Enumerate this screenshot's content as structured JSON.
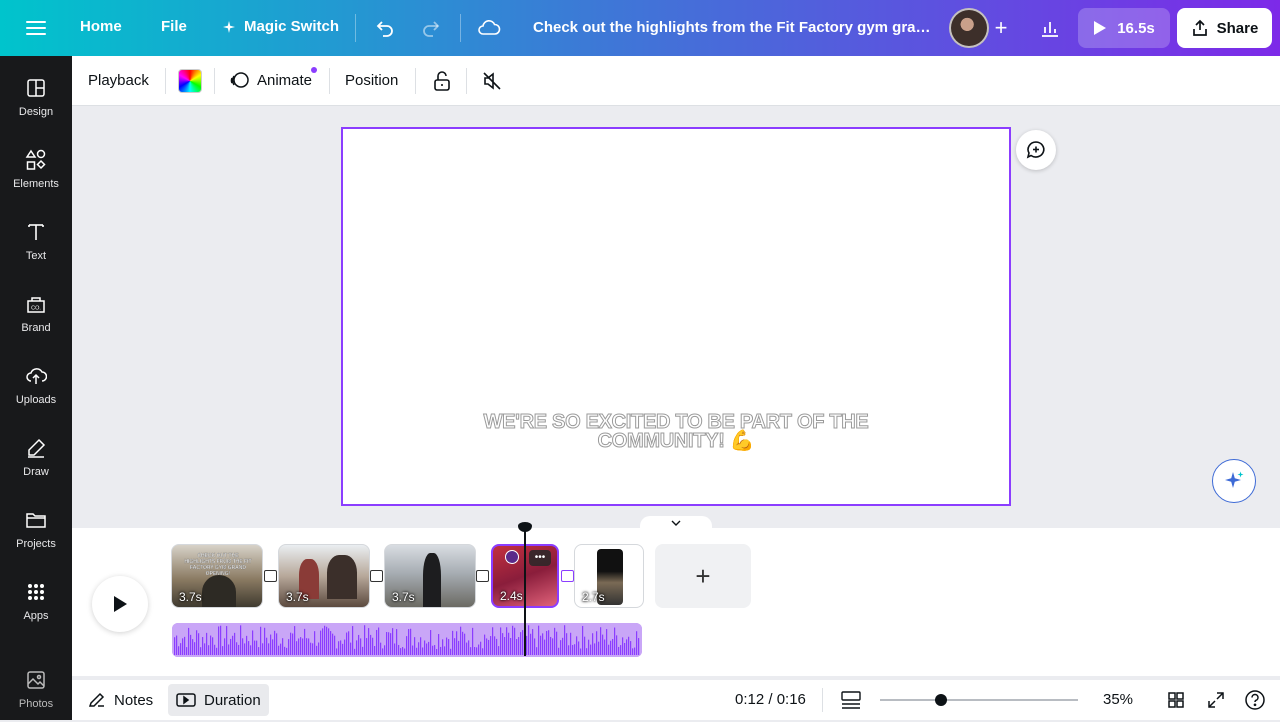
{
  "header": {
    "nav": [
      "Home",
      "File"
    ],
    "magic_switch": "Magic Switch",
    "doc_title": "Check out the highlights from the Fit Factory gym grand opening",
    "duration_button": "16.5s",
    "share": "Share"
  },
  "sidebar": {
    "items": [
      {
        "label": "Design",
        "icon": "design-icon"
      },
      {
        "label": "Elements",
        "icon": "elements-icon"
      },
      {
        "label": "Text",
        "icon": "text-icon"
      },
      {
        "label": "Brand",
        "icon": "brand-icon"
      },
      {
        "label": "Uploads",
        "icon": "uploads-icon"
      },
      {
        "label": "Draw",
        "icon": "draw-icon"
      },
      {
        "label": "Projects",
        "icon": "projects-icon"
      },
      {
        "label": "Apps",
        "icon": "apps-icon"
      },
      {
        "label": "Photos",
        "icon": "photos-icon"
      }
    ]
  },
  "toolbar": {
    "playback": "Playback",
    "animate": "Animate",
    "position": "Position"
  },
  "canvas": {
    "caption_line1": "WE'RE SO EXCITED TO BE PART OF THE",
    "caption_line2": "COMMUNITY! 💪"
  },
  "timeline": {
    "clips": [
      {
        "duration": "3.7s",
        "thumb_text": "CHECK OUT THE HIGHLIGHTS FROM THE FIT FACTORY GYM GRAND OPENING!",
        "selected": false
      },
      {
        "duration": "3.7s",
        "selected": false
      },
      {
        "duration": "3.7s",
        "selected": false
      },
      {
        "duration": "2.4s",
        "selected": true
      },
      {
        "duration": "2.7s",
        "selected": false
      }
    ]
  },
  "bottom": {
    "notes": "Notes",
    "duration": "Duration",
    "time": "0:12 / 0:16",
    "zoom": "35%"
  },
  "colors": {
    "accent": "#8b3dff",
    "sidebar_bg": "#18191b",
    "canvas_bg": "#ebecf0"
  }
}
